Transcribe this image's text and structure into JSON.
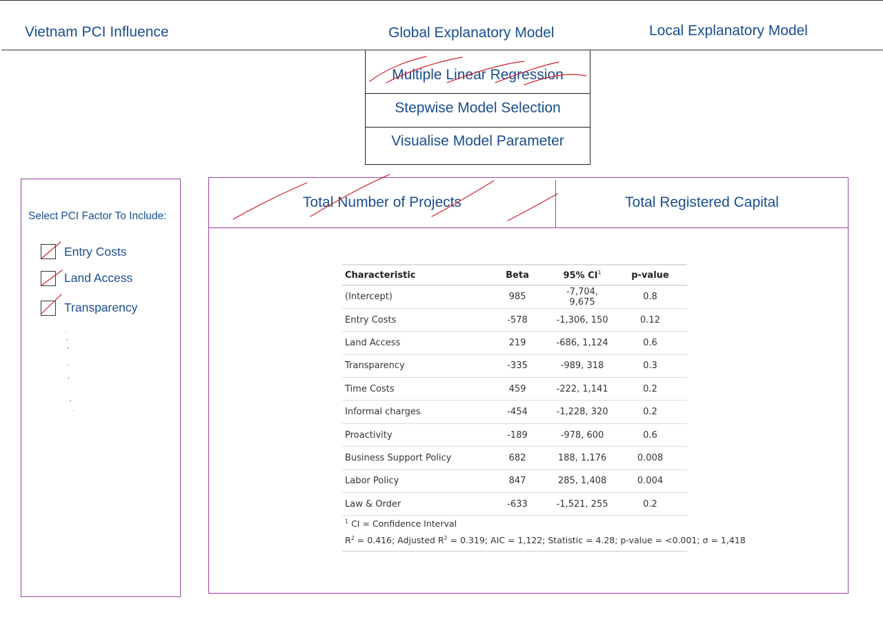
{
  "nav": {
    "item1": "Vietnam PCI Influence",
    "item2": "Global Explanatory Model",
    "item3": "Local Explanatory Model"
  },
  "menu": {
    "items": [
      "Multiple Linear Regression",
      "Stepwise Model Selection",
      "Visualise Model Parameter"
    ]
  },
  "sidebar": {
    "title": "Select PCI Factor To Include:",
    "checkboxes": [
      {
        "label": "Entry Costs",
        "checked": true
      },
      {
        "label": "Land Access",
        "checked": true
      },
      {
        "label": "Transparency",
        "checked": true
      }
    ]
  },
  "tabs": [
    "Total Number of Projects",
    "Total Registered Capital"
  ],
  "table": {
    "headers": [
      "Characteristic",
      "Beta",
      "95% CI",
      "p-value"
    ],
    "header_sup": "1",
    "rows": [
      [
        "(Intercept)",
        "985",
        "-7,704, 9,675",
        "0.8"
      ],
      [
        "Entry Costs",
        "-578",
        "-1,306, 150",
        "0.12"
      ],
      [
        "Land Access",
        "219",
        "-686, 1,124",
        "0.6"
      ],
      [
        "Transparency",
        "-335",
        "-989, 318",
        "0.3"
      ],
      [
        "Time Costs",
        "459",
        "-222, 1,141",
        "0.2"
      ],
      [
        "Informal charges",
        "-454",
        "-1,228, 320",
        "0.2"
      ],
      [
        "Proactivity",
        "-189",
        "-978, 600",
        "0.6"
      ],
      [
        "Business Support Policy",
        "682",
        "188, 1,176",
        "0.008"
      ],
      [
        "Labor Policy",
        "847",
        "285, 1,408",
        "0.004"
      ],
      [
        "Law & Order",
        "-633",
        "-1,521, 255",
        "0.2"
      ]
    ],
    "footnote_sup": "1",
    "footnote": "CI = Confidence Interval",
    "stats": {
      "r2_label": "R",
      "r2_rest": " = 0.416; Adjusted R",
      "tail": " = 0.319; AIC = 1,122; Statistic = 4.28; p-value = <0.001; σ = 1,418",
      "sq": "2"
    }
  },
  "colors": {
    "text_blue": "#1a4d8f",
    "panel_border": "#a040a8",
    "sketch_red": "#cc1f2a"
  }
}
